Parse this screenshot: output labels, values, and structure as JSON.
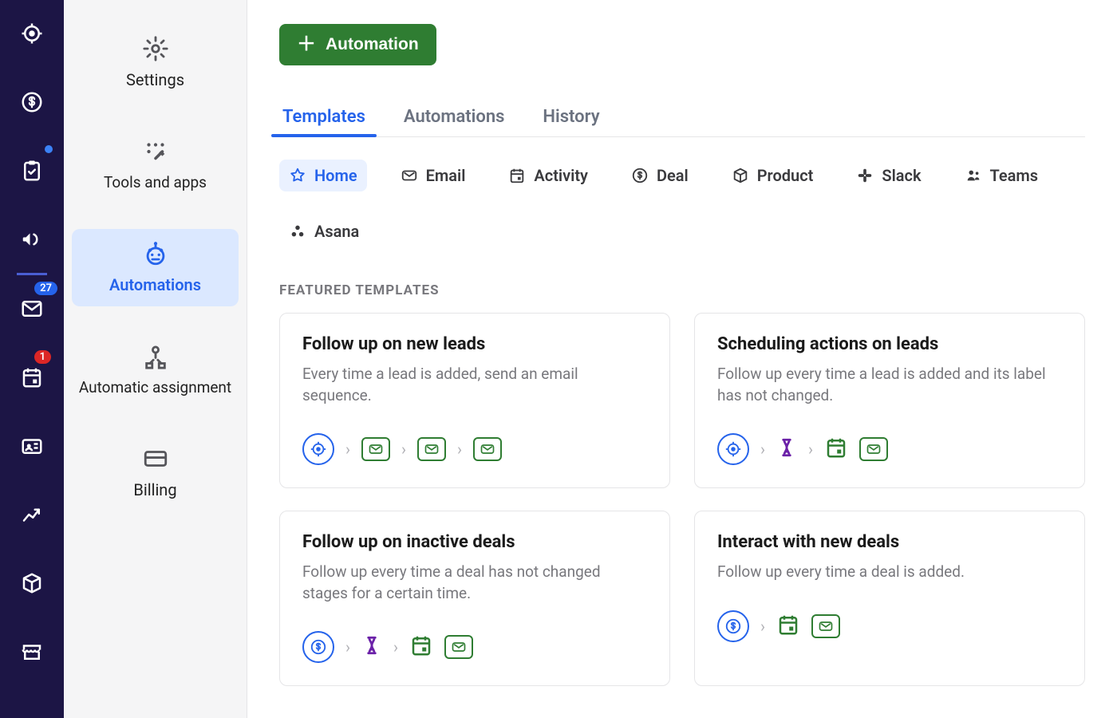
{
  "rail": {
    "badges": {
      "mail": "27",
      "calendar": "1"
    }
  },
  "subnav": {
    "items": [
      {
        "label": "Settings"
      },
      {
        "label": "Tools and apps"
      },
      {
        "label": "Automations"
      },
      {
        "label": "Automatic assignment"
      },
      {
        "label": "Billing"
      }
    ]
  },
  "header": {
    "automation_btn": "Automation"
  },
  "tabs": [
    {
      "label": "Templates"
    },
    {
      "label": "Automations"
    },
    {
      "label": "History"
    }
  ],
  "chips": [
    {
      "label": "Home"
    },
    {
      "label": "Email"
    },
    {
      "label": "Activity"
    },
    {
      "label": "Deal"
    },
    {
      "label": "Product"
    },
    {
      "label": "Slack"
    },
    {
      "label": "Teams"
    },
    {
      "label": "Asana"
    }
  ],
  "section_label": "FEATURED TEMPLATES",
  "templates": [
    {
      "title": "Follow up on new leads",
      "desc": "Every time a lead is added, send an email sequence."
    },
    {
      "title": "Scheduling actions on leads",
      "desc": "Follow up every time a lead is added and its label has not changed."
    },
    {
      "title": "Follow up on inactive deals",
      "desc": "Follow up every time a deal has not changed stages for a certain time."
    },
    {
      "title": "Interact with new deals",
      "desc": "Follow up every time a deal is added."
    }
  ]
}
